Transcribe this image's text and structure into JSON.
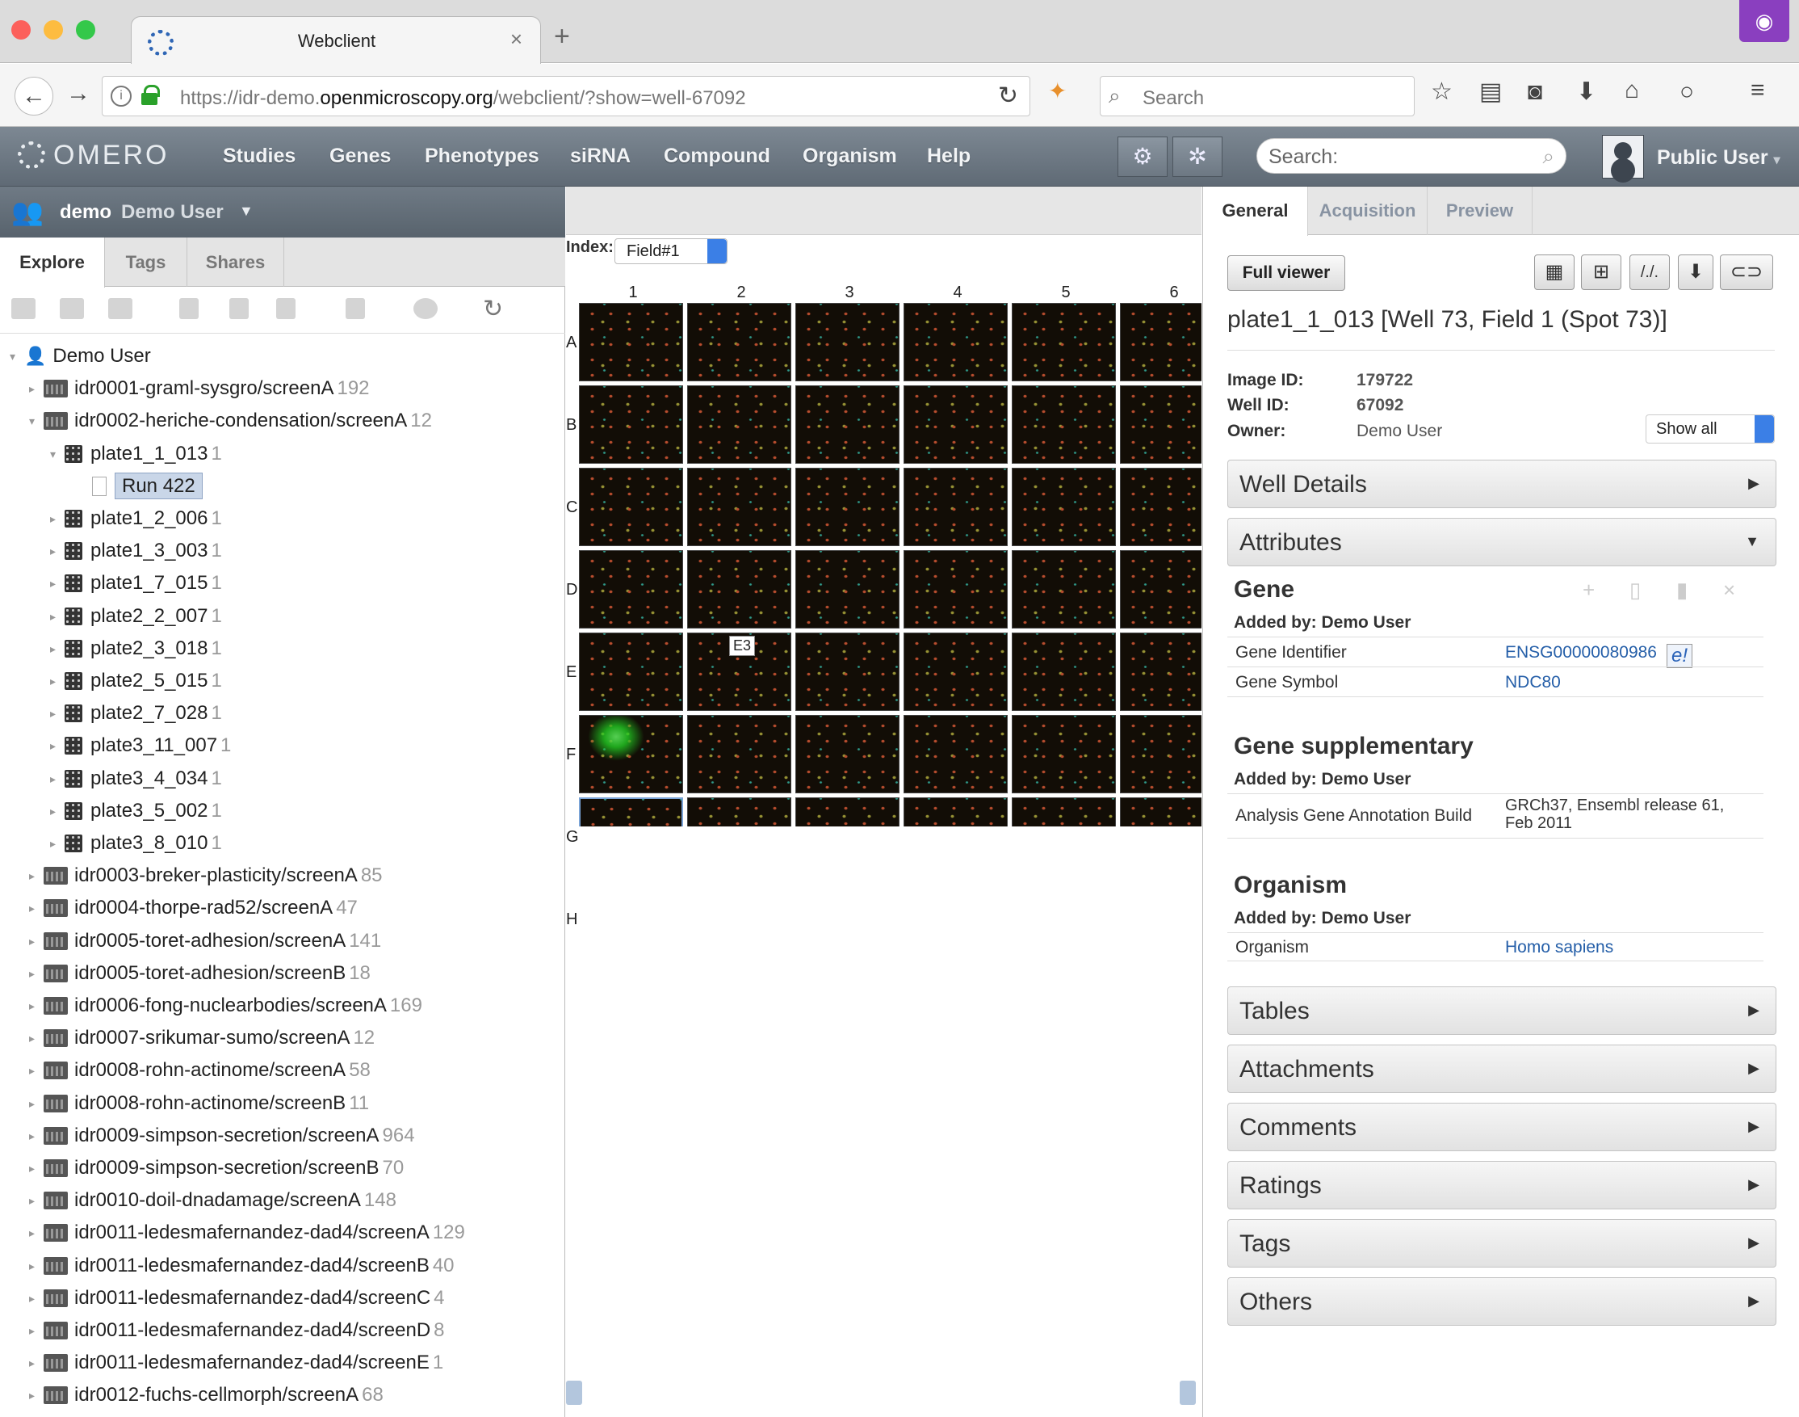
{
  "browser": {
    "tab_title": "Webclient",
    "url_prefix": "https://idr-demo.",
    "url_domain": "openmicroscopy.org",
    "url_path": "/webclient/?show=well-67092",
    "search_placeholder": "Search"
  },
  "omero": {
    "logo": "OMERO",
    "menu": [
      "Studies",
      "Genes",
      "Phenotypes",
      "siRNA",
      "Compound",
      "Organism",
      "Help"
    ],
    "search_placeholder": "Search:",
    "user": "Public User"
  },
  "left": {
    "group": "demo",
    "user": "Demo User",
    "tabs": [
      "Explore",
      "Tags",
      "Shares"
    ],
    "tree": [
      {
        "label": "Demo User",
        "count": "",
        "type": "user",
        "level": 0
      },
      {
        "label": "idr0001-graml-sysgro/screenA",
        "count": "192",
        "type": "screen",
        "level": 1
      },
      {
        "label": "idr0002-heriche-condensation/screenA",
        "count": "12",
        "type": "screen",
        "level": 1
      },
      {
        "label": "plate1_1_013",
        "count": "1",
        "type": "plate",
        "level": 2
      },
      {
        "label": "Run 422",
        "count": "",
        "type": "run",
        "level": 3
      },
      {
        "label": "plate1_2_006",
        "count": "1",
        "type": "plate",
        "level": 2
      },
      {
        "label": "plate1_3_003",
        "count": "1",
        "type": "plate",
        "level": 2
      },
      {
        "label": "plate1_7_015",
        "count": "1",
        "type": "plate",
        "level": 2
      },
      {
        "label": "plate2_2_007",
        "count": "1",
        "type": "plate",
        "level": 2
      },
      {
        "label": "plate2_3_018",
        "count": "1",
        "type": "plate",
        "level": 2
      },
      {
        "label": "plate2_5_015",
        "count": "1",
        "type": "plate",
        "level": 2
      },
      {
        "label": "plate2_7_028",
        "count": "1",
        "type": "plate",
        "level": 2
      },
      {
        "label": "plate3_11_007",
        "count": "1",
        "type": "plate",
        "level": 2
      },
      {
        "label": "plate3_4_034",
        "count": "1",
        "type": "plate",
        "level": 2
      },
      {
        "label": "plate3_5_002",
        "count": "1",
        "type": "plate",
        "level": 2
      },
      {
        "label": "plate3_8_010",
        "count": "1",
        "type": "plate",
        "level": 2
      },
      {
        "label": "idr0003-breker-plasticity/screenA",
        "count": "85",
        "type": "screen",
        "level": 1
      },
      {
        "label": "idr0004-thorpe-rad52/screenA",
        "count": "47",
        "type": "screen",
        "level": 1
      },
      {
        "label": "idr0005-toret-adhesion/screenA",
        "count": "141",
        "type": "screen",
        "level": 1
      },
      {
        "label": "idr0005-toret-adhesion/screenB",
        "count": "18",
        "type": "screen",
        "level": 1
      },
      {
        "label": "idr0006-fong-nuclearbodies/screenA",
        "count": "169",
        "type": "screen",
        "level": 1
      },
      {
        "label": "idr0007-srikumar-sumo/screenA",
        "count": "12",
        "type": "screen",
        "level": 1
      },
      {
        "label": "idr0008-rohn-actinome/screenA",
        "count": "58",
        "type": "screen",
        "level": 1
      },
      {
        "label": "idr0008-rohn-actinome/screenB",
        "count": "11",
        "type": "screen",
        "level": 1
      },
      {
        "label": "idr0009-simpson-secretion/screenA",
        "count": "964",
        "type": "screen",
        "level": 1
      },
      {
        "label": "idr0009-simpson-secretion/screenB",
        "count": "70",
        "type": "screen",
        "level": 1
      },
      {
        "label": "idr0010-doil-dnadamage/screenA",
        "count": "148",
        "type": "screen",
        "level": 1
      },
      {
        "label": "idr0011-ledesmafernandez-dad4/screenA",
        "count": "129",
        "type": "screen",
        "level": 1
      },
      {
        "label": "idr0011-ledesmafernandez-dad4/screenB",
        "count": "40",
        "type": "screen",
        "level": 1
      },
      {
        "label": "idr0011-ledesmafernandez-dad4/screenC",
        "count": "4",
        "type": "screen",
        "level": 1
      },
      {
        "label": "idr0011-ledesmafernandez-dad4/screenD",
        "count": "8",
        "type": "screen",
        "level": 1
      },
      {
        "label": "idr0011-ledesmafernandez-dad4/screenE",
        "count": "1",
        "type": "screen",
        "level": 1
      },
      {
        "label": "idr0012-fuchs-cellmorph/screenA",
        "count": "68",
        "type": "screen",
        "level": 1
      }
    ]
  },
  "center": {
    "index_label": "Index:",
    "field": "Field#1",
    "columns": [
      "1",
      "2",
      "3",
      "4",
      "5",
      "6"
    ],
    "rows": [
      "A",
      "B",
      "C",
      "D",
      "E",
      "F",
      "G",
      "H"
    ],
    "tooltip": "E3"
  },
  "right": {
    "tabs": [
      "General",
      "Acquisition",
      "Preview"
    ],
    "full_viewer": "Full viewer",
    "image_title": "plate1_1_013 [Well 73, Field 1 (Spot 73)]",
    "image_id_label": "Image ID:",
    "image_id": "179722",
    "well_id_label": "Well ID:",
    "well_id": "67092",
    "owner_label": "Owner:",
    "owner": "Demo User",
    "show_all": "Show all",
    "well_details": "Well Details",
    "attributes": "Attributes",
    "gene": {
      "title": "Gene",
      "added_by": "Added by: Demo User",
      "rows": [
        {
          "key": "Gene Identifier",
          "value": "ENSG00000080986"
        },
        {
          "key": "Gene Symbol",
          "value": "NDC80"
        }
      ]
    },
    "gene_supp": {
      "title": "Gene supplementary",
      "added_by": "Added by: Demo User",
      "key": "Analysis Gene Annotation Build",
      "value_line1": "GRCh37, Ensembl release 61,",
      "value_line2": "Feb 2011"
    },
    "organism": {
      "title": "Organism",
      "added_by": "Added by: Demo User",
      "key": "Organism",
      "value": "Homo sapiens"
    },
    "accordions": [
      "Tables",
      "Attachments",
      "Comments",
      "Ratings",
      "Tags",
      "Others"
    ]
  }
}
